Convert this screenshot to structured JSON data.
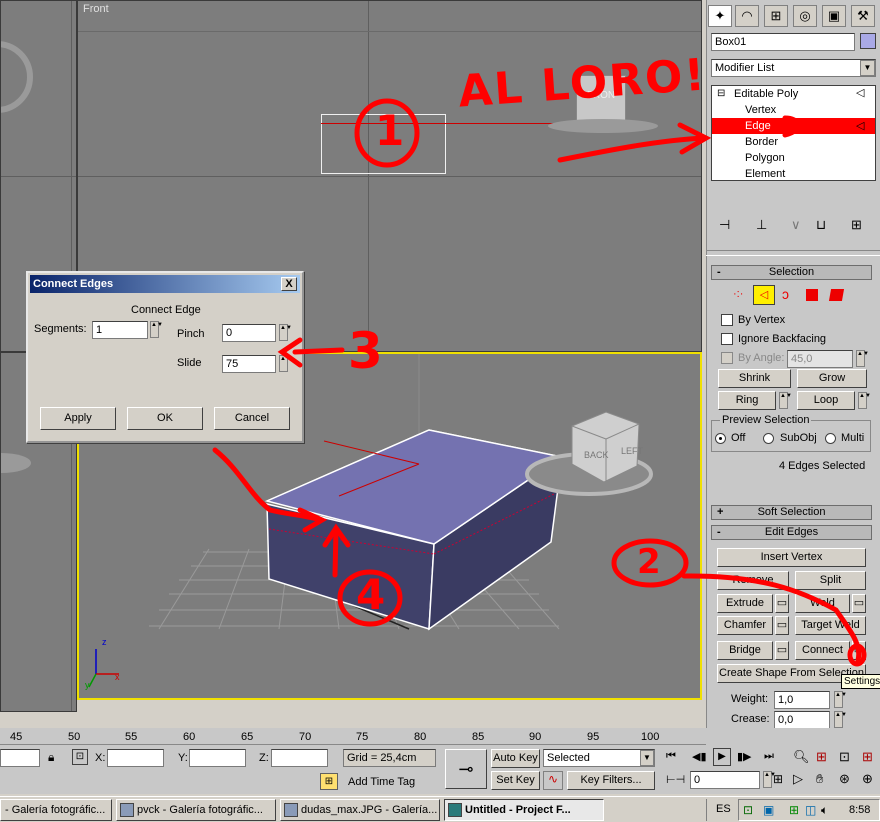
{
  "viewports": {
    "top_left_label": "",
    "front_label": "Front",
    "front_gizmo_text": "FRON",
    "persp_cube_faces": [
      "BACK",
      "LEFT"
    ],
    "coord_axes": [
      "z",
      "x",
      "y"
    ]
  },
  "command_panel": {
    "tabs": [
      "create-icon",
      "modify-icon",
      "hierarchy-icon",
      "motion-icon",
      "display-icon",
      "utilities-icon"
    ],
    "object_name": "Box01",
    "object_color": "#a9a9e6",
    "modifier_list": "Modifier List",
    "stack": {
      "root": "Editable Poly",
      "items": [
        "Vertex",
        "Edge",
        "Border",
        "Polygon",
        "Element"
      ],
      "selected_index": 1
    }
  },
  "selection_rollout": {
    "title": "Selection",
    "by_vertex": "By Vertex",
    "ignore_backfacing": "Ignore Backfacing",
    "by_angle": "By Angle:",
    "by_angle_value": "45,0",
    "shrink": "Shrink",
    "grow": "Grow",
    "ring": "Ring",
    "loop": "Loop",
    "preview_title": "Preview Selection",
    "preview_options": [
      "Off",
      "SubObj",
      "Multi"
    ],
    "status": "4 Edges Selected"
  },
  "soft_selection": {
    "title": "Soft Selection"
  },
  "edit_edges": {
    "title": "Edit Edges",
    "insert_vertex": "Insert Vertex",
    "remove": "Remove",
    "split": "Split",
    "extrude": "Extrude",
    "weld": "Weld",
    "chamfer": "Chamfer",
    "target_weld": "Target Weld",
    "bridge": "Bridge",
    "connect": "Connect",
    "create_shape": "Create Shape From Selection",
    "tooltip": "Settings",
    "weight_label": "Weight:",
    "weight_value": "1,0",
    "crease_label": "Crease:",
    "crease_value": "0,0"
  },
  "dialog": {
    "title": "Connect Edges",
    "group": "Connect Edge",
    "segments_label": "Segments:",
    "segments_value": "1",
    "pinch_label": "Pinch",
    "pinch_value": "0",
    "slide_label": "Slide",
    "slide_value": "75",
    "apply": "Apply",
    "ok": "OK",
    "cancel": "Cancel",
    "close": "X"
  },
  "timeline": {
    "ticks": [
      "45",
      "50",
      "55",
      "60",
      "65",
      "70",
      "75",
      "80",
      "85",
      "90",
      "95",
      "100"
    ]
  },
  "status_bar": {
    "x_label": "X:",
    "y_label": "Y:",
    "z_label": "Z:",
    "grid": "Grid = 25,4cm",
    "add_time_tag": "Add Time Tag",
    "auto_key": "Auto Key",
    "set_key": "Set Key",
    "selected": "Selected",
    "key_filters": "Key Filters...",
    "frame": "0"
  },
  "taskbar": {
    "tasks": [
      "- Galería fotográfic...",
      "pvck - Galería fotográfic...",
      "dudas_max.JPG - Galería...",
      "Untitled    - Project F..."
    ],
    "language": "ES",
    "clock": "8:58"
  },
  "annotations": {
    "al_loro": "AL LORO!",
    "num1": "1",
    "num2": "2",
    "num3": "3",
    "num4": "4"
  }
}
